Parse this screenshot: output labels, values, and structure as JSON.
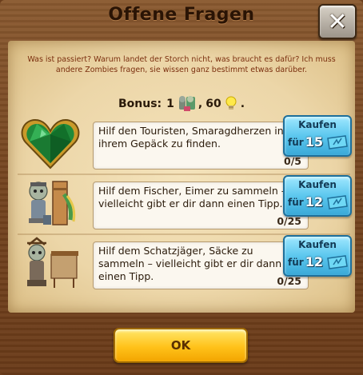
{
  "dialog": {
    "title": "Offene Fragen",
    "close_label": "✕",
    "intro": "Was ist passiert? Warum landet der Storch nicht, was braucht es dafür? Ich muss andere Zombies fragen, sie wissen ganz bestimmt etwas darüber.",
    "ok_label": "OK"
  },
  "bonus": {
    "label": "Bonus:",
    "zombie_count": "1",
    "coin_separator": ",",
    "xp_value": "60",
    "end_mark": "."
  },
  "quests": [
    {
      "text": "Hilf den Touristen, Smaragdherzen in ihrem Gepäck zu finden.",
      "progress": "0/5",
      "buy_label": "Kaufen",
      "buy_prefix": "für",
      "buy_price": "15",
      "image": "emerald-heart-icon"
    },
    {
      "text": "Hilf dem Fischer, Eimer zu sammeln – vielleicht gibt er dir dann einen Tipp.",
      "progress": "0/25",
      "buy_label": "Kaufen",
      "buy_prefix": "für",
      "buy_price": "12",
      "image": "fisherman-zombie-icon"
    },
    {
      "text": "Hilf dem Schatzjäger, Säcke zu sammeln – vielleicht gibt er dir dann einen Tipp.",
      "progress": "0/25",
      "buy_label": "Kaufen",
      "buy_prefix": "für",
      "buy_price": "12",
      "image": "treasure-hunter-zombie-icon"
    }
  ],
  "colors": {
    "wood": "#74441f",
    "parchment": "#ecd6a8",
    "buy_button": "#5cc7ee",
    "ok_button": "#ffc21a",
    "intro_text": "#7a2e0e"
  }
}
